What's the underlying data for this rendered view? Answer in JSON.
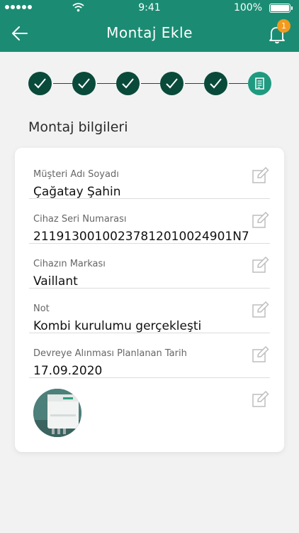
{
  "status_bar": {
    "time": "9:41",
    "battery": "100%"
  },
  "header": {
    "title": "Montaj Ekle",
    "notification_count": "1"
  },
  "steps": {
    "total": 6,
    "completed": 5
  },
  "section": {
    "title": "Montaj bilgileri"
  },
  "fields": [
    {
      "label": "Müşteri Adı Soyadı",
      "value": "Çağatay Şahin"
    },
    {
      "label": "Cihaz Seri Numarası",
      "value": "21191300100237812010024901N7"
    },
    {
      "label": "Cihazın Markası",
      "value": "Vaillant"
    },
    {
      "label": "Not",
      "value": "Kombi kurulumu gerçekleşti"
    },
    {
      "label": "Devreye Alınması Planlanan Tarih",
      "value": "17.09.2020"
    }
  ],
  "colors": {
    "header": "#1b8c73",
    "step_done": "#0a4a3a",
    "step_current": "#1f9a80",
    "badge": "#f39a1e"
  },
  "icons": [
    "back-arrow-icon",
    "bell-icon",
    "check-icon",
    "document-icon",
    "edit-icon",
    "wifi-icon"
  ]
}
